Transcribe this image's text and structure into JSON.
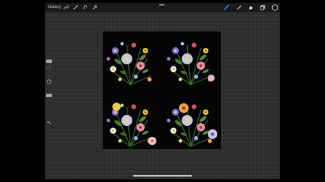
{
  "toolbar": {
    "gallery_label": "Gallery",
    "left_tools": [
      "wrench-icon",
      "magic-wand-icon",
      "selection-icon",
      "transform-arrow-icon"
    ],
    "right_tools": [
      "brush-icon",
      "smudge-icon",
      "eraser-icon",
      "layers-icon",
      "color-swatch-icon"
    ],
    "active_tool": "brush-icon",
    "brush_accent": "#3e8ff5",
    "current_color": "#111111"
  },
  "sidebar": {
    "brush_size_level": 0.5,
    "opacity_level": 0.5,
    "controls": [
      "brush-size-slider",
      "modify-button",
      "opacity-slider",
      "undo-icon"
    ]
  },
  "canvas": {
    "artwork": "floral-bouquet-artwork",
    "background": "#050505"
  }
}
